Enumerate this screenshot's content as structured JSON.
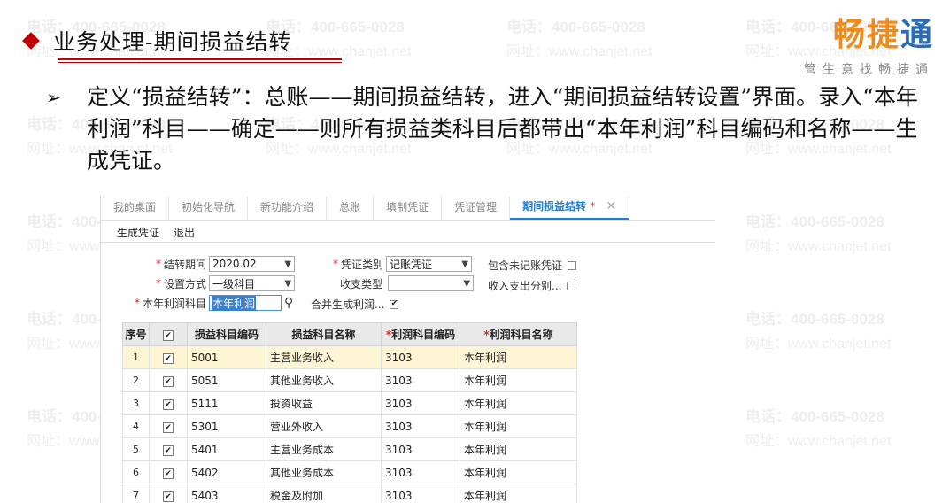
{
  "slide": {
    "title": "业务处理-期间损益结转",
    "bullet": "定义“损益结转”：总账——期间损益结转，进入“期间损益结转设置”界面。录入“本年利润”科目——确定——则所有损益类科目后都带出“本年利润”科目编码和名称——生成凭证。"
  },
  "logo": {
    "name_part1": "畅捷",
    "name_part2": "通",
    "tagline": "管生意找畅捷通"
  },
  "watermark": {
    "phone": "电话：400-665-0028",
    "site": "网址：www.chanjet.net"
  },
  "app": {
    "tabs": [
      {
        "label": "我的桌面"
      },
      {
        "label": "初始化导航"
      },
      {
        "label": "新功能介绍"
      },
      {
        "label": "总账"
      },
      {
        "label": "填制凭证"
      },
      {
        "label": "凭证管理"
      }
    ],
    "active_tab": {
      "label": "期间损益结转",
      "modified_mark": "*"
    },
    "toolbar": {
      "generate_label": "生成凭证",
      "exit_label": "退出"
    },
    "form": {
      "required_mark": "*",
      "period_label": "结转期间",
      "period_value": "2020.02",
      "method_label": "设置方式",
      "method_value": "一级科目",
      "profit_label": "本年利润科目",
      "profit_value": "本年利润",
      "voucher_type_label": "凭证类别",
      "voucher_type_value": "记账凭证",
      "income_type_label": "收支类型",
      "income_type_value": "",
      "merge_label": "合并生成利润...",
      "include_unposted_label": "包含未记账凭证",
      "split_label": "收入支出分别..."
    },
    "table": {
      "headers": {
        "seq": "序号",
        "code": "损益科目编码",
        "name": "损益科目名称",
        "profit_code": "利润科目编码",
        "profit_name": "利润科目名称"
      },
      "required_mark": "*",
      "rows": [
        {
          "seq": "1",
          "code": "5001",
          "name": "主营业务收入",
          "profit_code": "3103",
          "profit_name": "本年利润"
        },
        {
          "seq": "2",
          "code": "5051",
          "name": "其他业务收入",
          "profit_code": "3103",
          "profit_name": "本年利润"
        },
        {
          "seq": "3",
          "code": "5111",
          "name": "投资收益",
          "profit_code": "3103",
          "profit_name": "本年利润"
        },
        {
          "seq": "4",
          "code": "5301",
          "name": "营业外收入",
          "profit_code": "3103",
          "profit_name": "本年利润"
        },
        {
          "seq": "5",
          "code": "5401",
          "name": "主营业务成本",
          "profit_code": "3103",
          "profit_name": "本年利润"
        },
        {
          "seq": "6",
          "code": "5402",
          "name": "其他业务成本",
          "profit_code": "3103",
          "profit_name": "本年利润"
        },
        {
          "seq": "7",
          "code": "5403",
          "name": "税金及附加",
          "profit_code": "3103",
          "profit_name": "本年利润"
        }
      ]
    }
  }
}
